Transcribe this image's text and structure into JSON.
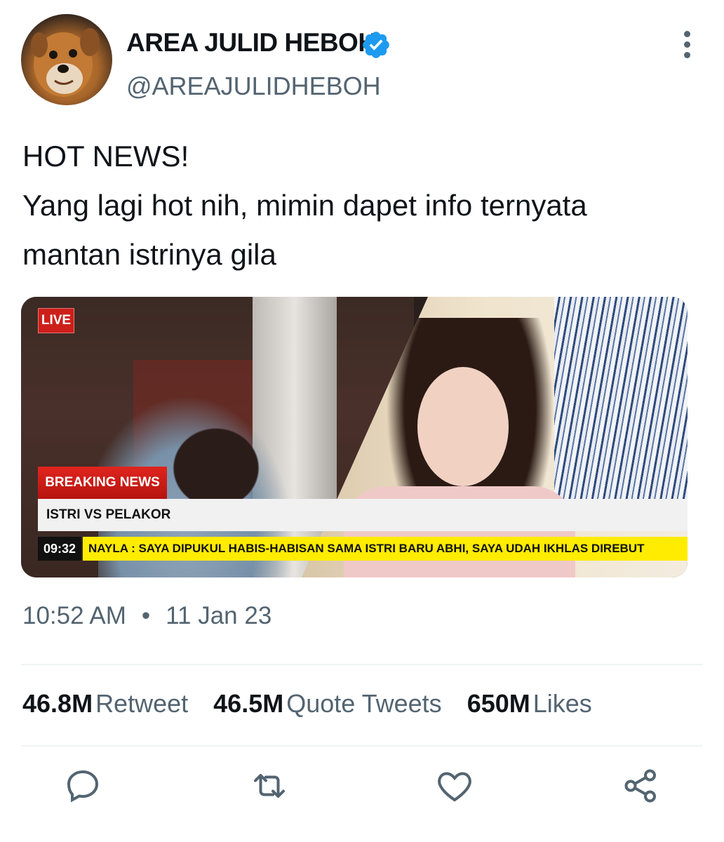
{
  "author": {
    "display_name": "AREA JULID HEBOH",
    "handle": "@AREAJULIDHEBOH",
    "verified": true,
    "avatar_icon": "dog-avatar"
  },
  "tweet": {
    "lines": [
      "HOT NEWS!",
      "Yang lagi hot nih, mimin dapet info ternyata",
      "mantan istrinya gila"
    ]
  },
  "media": {
    "live_label": "LIVE",
    "breaking_label": "BREAKING NEWS",
    "headline": "ISTRI VS PELAKOR",
    "ticker_time": "09:32",
    "ticker_text": "NAYLA : SAYA DIPUKUL HABIS-HABISAN SAMA ISTRI BARU ABHI, SAYA UDAH IKHLAS DIREBUT"
  },
  "meta": {
    "time": "10:52 AM",
    "separator": "•",
    "date": "11 Jan 23"
  },
  "stats": [
    {
      "count": "46.8M",
      "label": "Retweet"
    },
    {
      "count": "46.5M",
      "label": "Quote Tweets"
    },
    {
      "count": "650M",
      "label": "Likes"
    }
  ],
  "actions": [
    "reply-icon",
    "retweet-icon",
    "like-icon",
    "share-icon"
  ],
  "colors": {
    "text_primary": "#0f1419",
    "text_secondary": "#536471",
    "verified_blue": "#1d9bf0",
    "breaking_red": "#cc1f1a",
    "ticker_yellow": "#ffec00"
  }
}
